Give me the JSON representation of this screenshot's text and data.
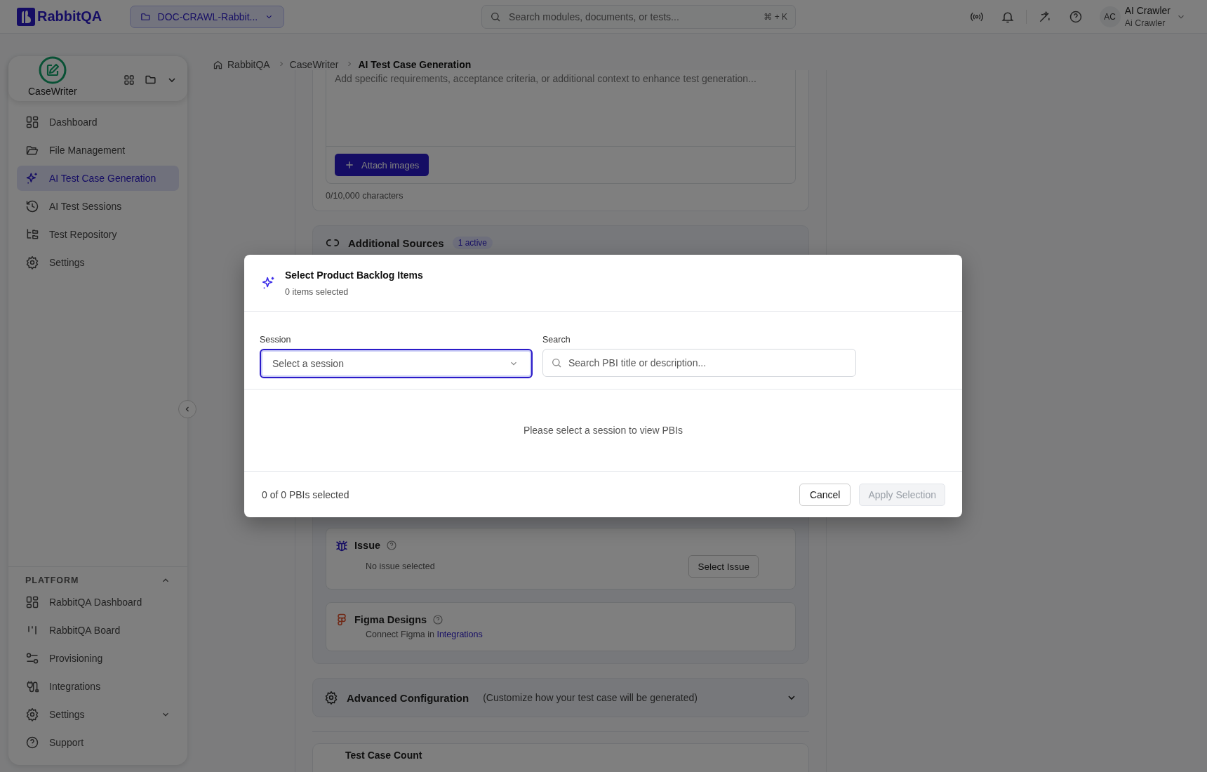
{
  "app": {
    "name": "RabbitQA"
  },
  "project_selector": {
    "label": "DOC-CRAWL-Rabbit..."
  },
  "search": {
    "placeholder": "Search modules, documents, or tests...",
    "shortcut": "⌘ + K"
  },
  "user": {
    "initials": "AC",
    "name": "AI Crawler",
    "subtitle": "Ai Crawler"
  },
  "sidebar": {
    "module": "CaseWriter",
    "items": [
      {
        "label": "Dashboard",
        "selected": false
      },
      {
        "label": "File Management",
        "selected": false
      },
      {
        "label": "AI Test Case Generation",
        "selected": true
      },
      {
        "label": "AI Test Sessions",
        "selected": false
      },
      {
        "label": "Test Repository",
        "selected": false
      },
      {
        "label": "Settings",
        "selected": false
      }
    ],
    "platform": {
      "title": "PLATFORM",
      "expanded": true,
      "items": [
        {
          "label": "RabbitQA Dashboard",
          "kind": "link"
        },
        {
          "label": "RabbitQA Board",
          "kind": "link"
        },
        {
          "label": "Provisioning",
          "kind": "link"
        },
        {
          "label": "Integrations",
          "kind": "link"
        },
        {
          "label": "Settings",
          "kind": "group",
          "expanded": false
        },
        {
          "label": "Support",
          "kind": "link"
        }
      ]
    }
  },
  "breadcrumb": [
    "RabbitQA",
    "CaseWriter",
    "AI Test Case Generation"
  ],
  "context_card": {
    "placeholder": "Add specific requirements, acceptance criteria, or additional context to enhance test generation...",
    "attach_button": "Attach images",
    "char_count": "0/10,000 characters"
  },
  "additional_sources": {
    "title": "Additional Sources",
    "badge": "1 active",
    "issue": {
      "title": "Issue",
      "status": "No issue selected",
      "button": "Select Issue"
    },
    "figma": {
      "title": "Figma Designs",
      "text_before": "Connect Figma in",
      "link": "Integrations"
    }
  },
  "advanced": {
    "title": "Advanced Configuration",
    "hint": "(Customize how your test case will be generated)",
    "expanded": false
  },
  "test_case_count": {
    "title": "Test Case Count"
  },
  "modal": {
    "title": "Select Product Backlog Items",
    "subtitle": "0 items selected",
    "session_label": "Session",
    "session_placeholder": "Select a session",
    "session_focused": true,
    "search_label": "Search",
    "search_placeholder": "Search PBI title or description...",
    "empty_text": "Please select a session to view PBIs",
    "footer_count": "0 of 0 PBIs selected",
    "cancel": "Cancel",
    "apply": "Apply Selection",
    "apply_disabled": true
  }
}
